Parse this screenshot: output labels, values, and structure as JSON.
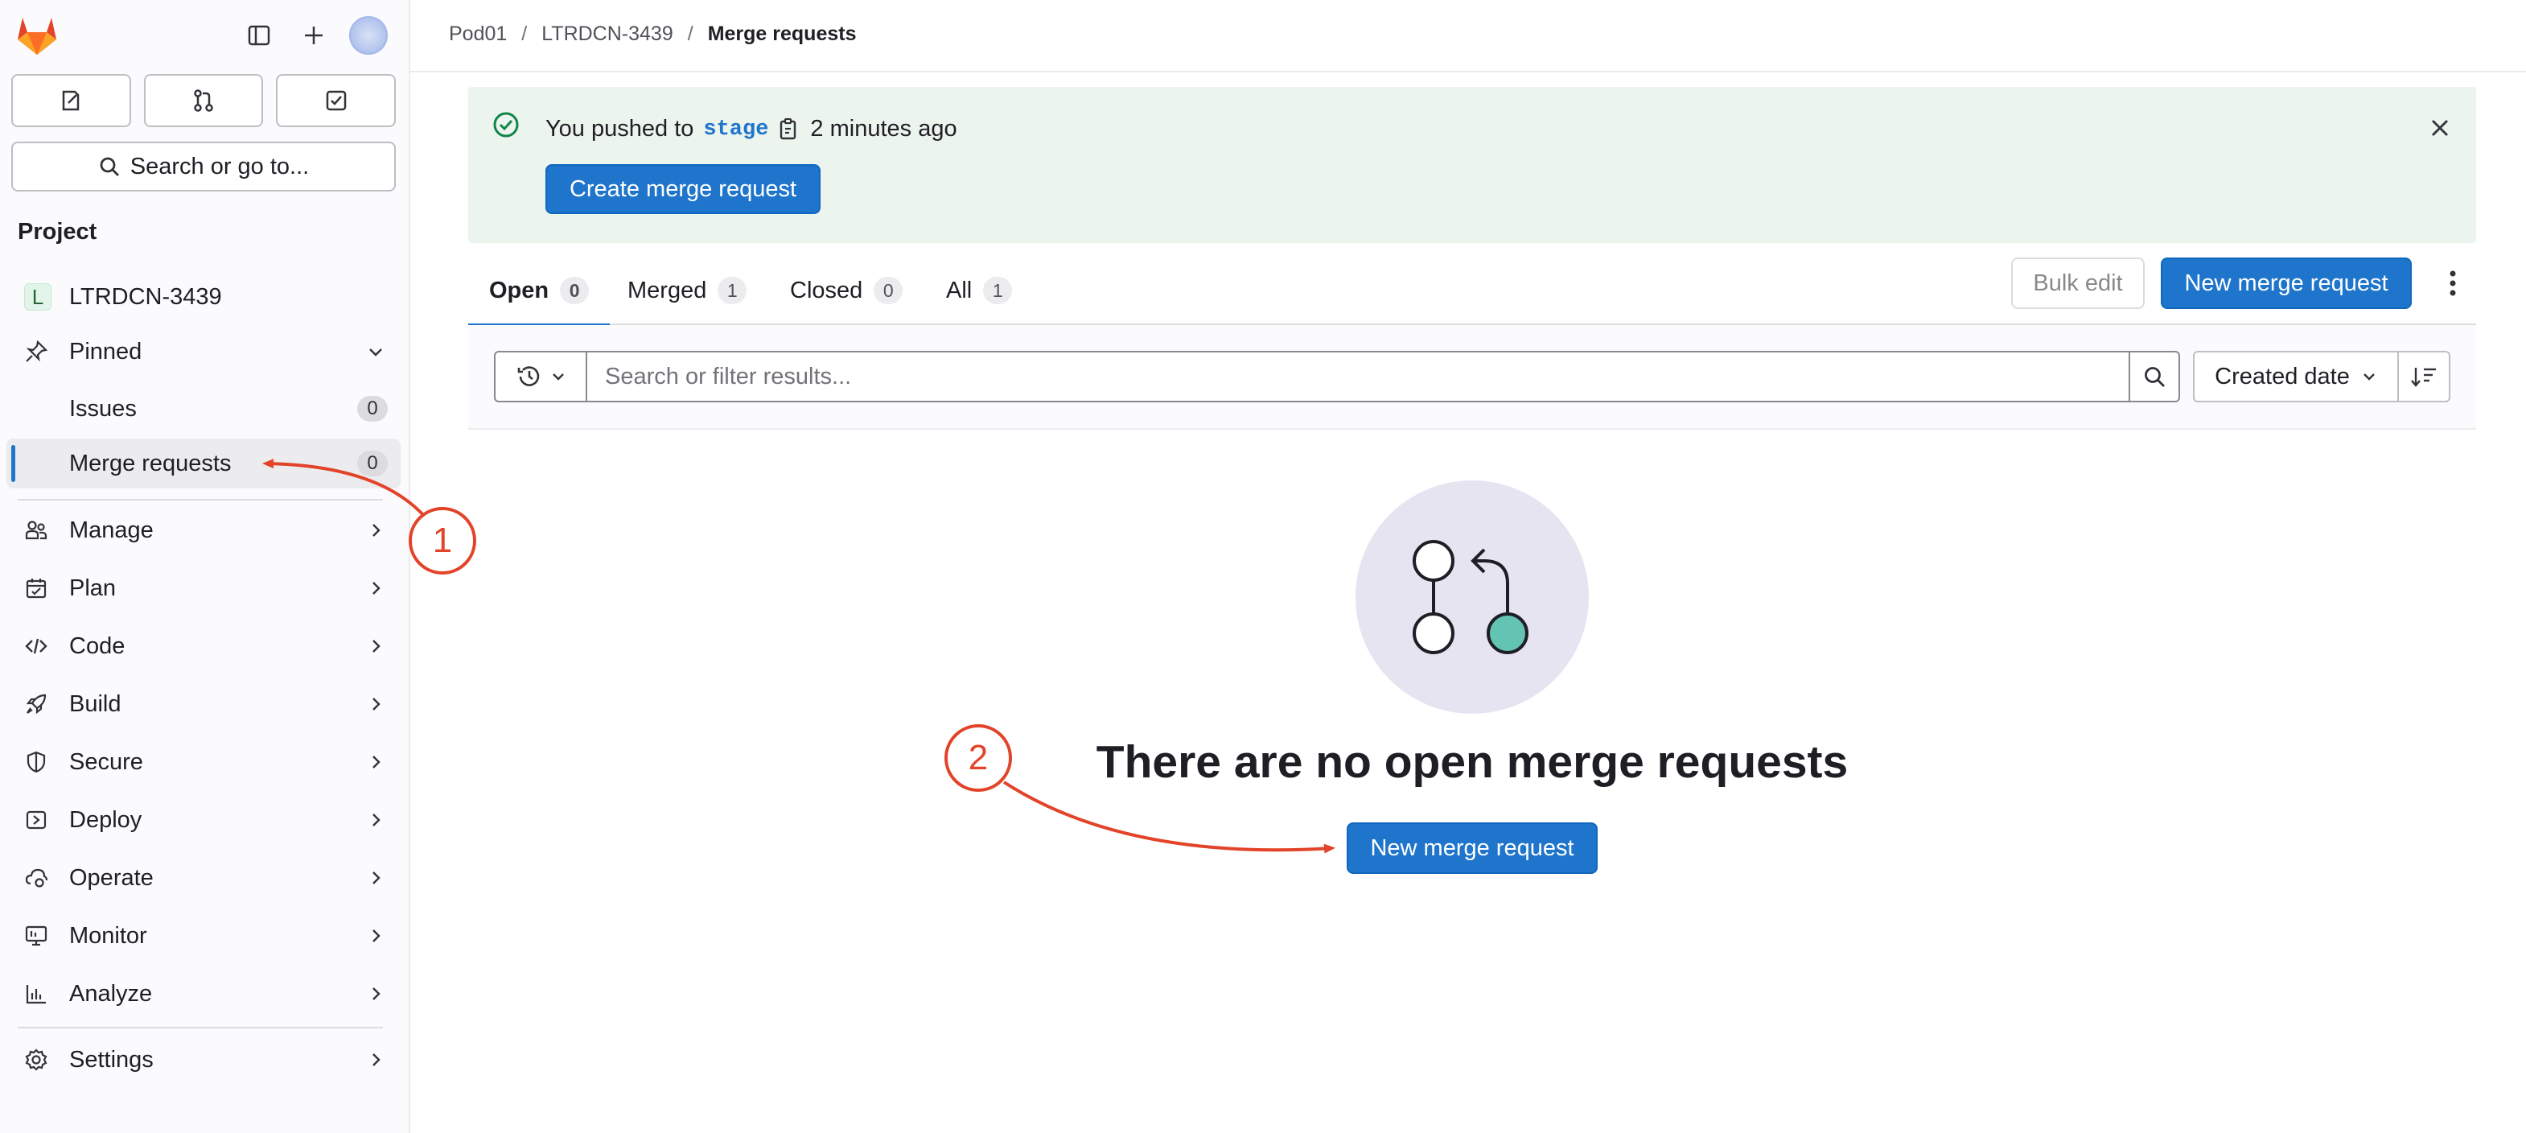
{
  "sidebar": {
    "search_label": "Search or go to...",
    "project_heading": "Project",
    "project_avatar_letter": "L",
    "project_name": "LTRDCN-3439",
    "pinned_label": "Pinned",
    "issues_label": "Issues",
    "issues_count": "0",
    "mr_label": "Merge requests",
    "mr_count": "0",
    "menu": [
      {
        "label": "Manage",
        "icon": "users-icon"
      },
      {
        "label": "Plan",
        "icon": "calendar-icon"
      },
      {
        "label": "Code",
        "icon": "code-icon"
      },
      {
        "label": "Build",
        "icon": "rocket-icon"
      },
      {
        "label": "Secure",
        "icon": "shield-icon"
      },
      {
        "label": "Deploy",
        "icon": "deploy-icon"
      },
      {
        "label": "Operate",
        "icon": "cloud-gear-icon"
      },
      {
        "label": "Monitor",
        "icon": "monitor-icon"
      },
      {
        "label": "Analyze",
        "icon": "chart-icon"
      }
    ],
    "settings_label": "Settings"
  },
  "breadcrumb": {
    "group": "Pod01",
    "project": "LTRDCN-3439",
    "current": "Merge requests",
    "separator": "/"
  },
  "alert": {
    "prefix": "You pushed to",
    "branch": "stage",
    "time": "2 minutes ago",
    "create_button": "Create merge request"
  },
  "tabs": [
    {
      "label": "Open",
      "count": "0"
    },
    {
      "label": "Merged",
      "count": "1"
    },
    {
      "label": "Closed",
      "count": "0"
    },
    {
      "label": "All",
      "count": "1"
    }
  ],
  "actions": {
    "bulk_edit": "Bulk edit",
    "new_mr": "New merge request"
  },
  "filter": {
    "placeholder": "Search or filter results...",
    "sort_label": "Created date"
  },
  "empty_state": {
    "title": "There are no open merge requests",
    "button": "New merge request"
  },
  "annotations": [
    "1",
    "2"
  ],
  "colors": {
    "accent": "#1f75cb",
    "annotation": "#e24329",
    "alert_bg": "#ecf4ee",
    "success": "#108548"
  }
}
